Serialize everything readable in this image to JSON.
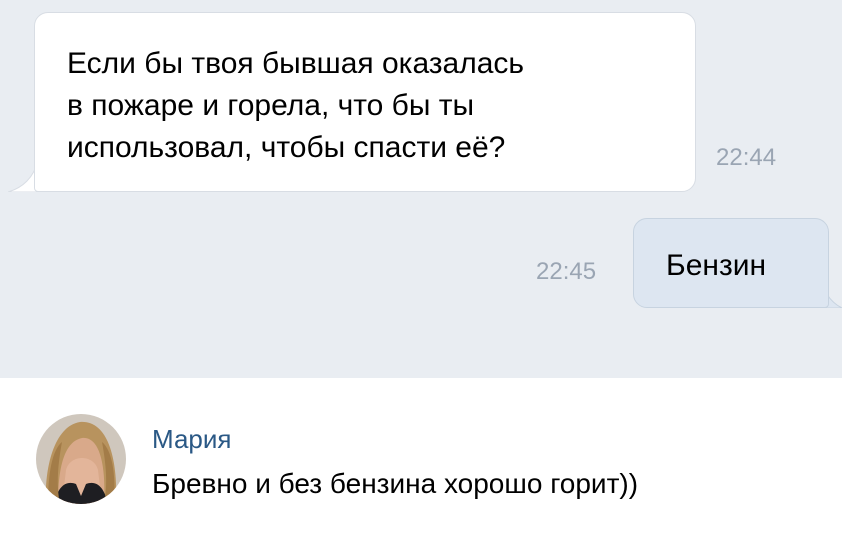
{
  "messages": [
    {
      "direction": "incoming",
      "lines": [
        "Если бы твоя бывшая оказалась",
        "в пожаре и горела, что бы ты",
        "использовал, чтобы спасти её?"
      ],
      "time": "22:44"
    },
    {
      "direction": "outgoing",
      "text": "Бензин",
      "time": "22:45"
    }
  ],
  "comment": {
    "author": "Мария",
    "text": "Бревно и без бензина хорошо горит))",
    "avatar_icon": "user-photo-avatar"
  },
  "colors": {
    "chat_background": "#e9edf2",
    "incoming_bubble": "#ffffff",
    "outgoing_bubble": "#dde6f1",
    "timestamp": "#9aa5b3",
    "author_name": "#2a5885"
  }
}
